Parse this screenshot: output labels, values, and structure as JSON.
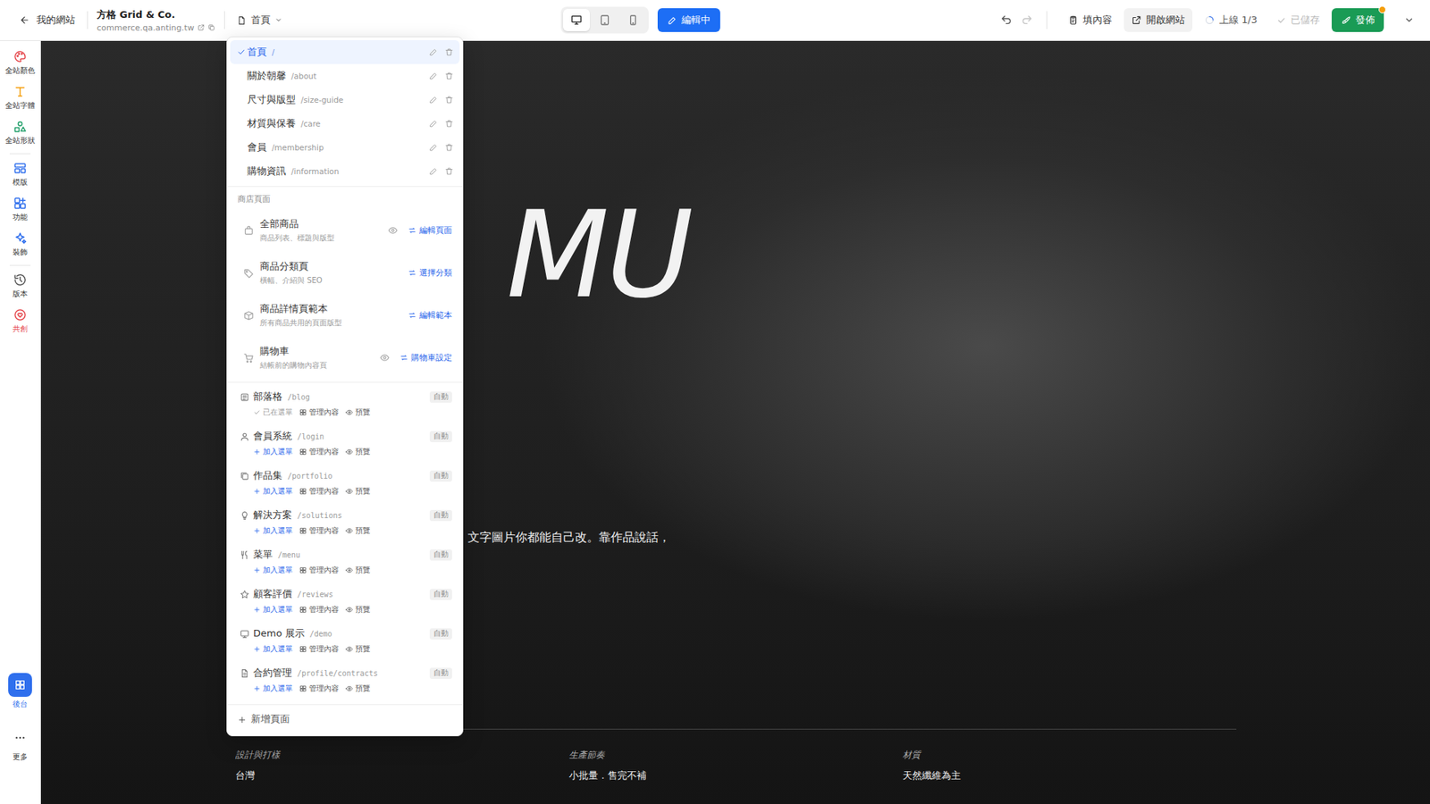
{
  "topbar": {
    "back": "我的網站",
    "site_name": "方格 Grid & Co.",
    "domain": "commerce.qa.anting.tw",
    "page_select": "首頁",
    "devices": [
      {
        "kind": "desktop",
        "selected": true
      },
      {
        "kind": "tablet",
        "selected": false
      },
      {
        "kind": "mobile",
        "selected": false
      }
    ],
    "edit_button": {
      "label": "編輯中",
      "selected": true
    },
    "undo": {
      "disabled": false
    },
    "redo": {
      "disabled": true
    },
    "fill_button": "填內容",
    "open_site": "開啟網站",
    "online": {
      "label": "上線 1/3",
      "loading": true
    },
    "saved": {
      "label": "已儲存",
      "disabled": true
    },
    "publish": {
      "label": "發佈",
      "pending_dot": true
    }
  },
  "sidebar": {
    "items": [
      {
        "label": "全站顏色",
        "color": "#e5484d",
        "highlight": false
      },
      {
        "label": "全站字體",
        "color": "#f59e0b",
        "highlight": false
      },
      {
        "label": "全站形狀",
        "color": "#22a06b",
        "highlight": false
      },
      {
        "label": "模版",
        "color": "#2f6fed",
        "highlight": false
      },
      {
        "label": "功能",
        "color": "#2f6fed",
        "highlight": false
      },
      {
        "label": "裝飾",
        "color": "#2f6fed",
        "highlight": false
      },
      {
        "label": "版本",
        "color": "#555555",
        "highlight": false
      },
      {
        "label": "共創",
        "color": "#e5484d",
        "highlight": true
      }
    ],
    "bottom": [
      {
        "label": "後台",
        "selected": true
      },
      {
        "label": "更多",
        "selected": false
      }
    ]
  },
  "page_menu": {
    "pages": [
      {
        "title": "首頁",
        "path": "/",
        "selected": true
      },
      {
        "title": "關於朝馨",
        "path": "/about",
        "selected": false
      },
      {
        "title": "尺寸與版型",
        "path": "/size-guide",
        "selected": false
      },
      {
        "title": "材質與保養",
        "path": "/care",
        "selected": false
      },
      {
        "title": "會員",
        "path": "/membership",
        "selected": false
      },
      {
        "title": "購物資訊",
        "path": "/information",
        "selected": false
      }
    ],
    "store_section": "商店頁面",
    "store_pages": [
      {
        "title": "全部商品",
        "subtitle": "商品列表、標題與版型",
        "preview_eye": true,
        "action": "編輯頁面"
      },
      {
        "title": "商品分類頁",
        "subtitle": "橫幅、介紹與 SEO",
        "preview_eye": false,
        "action": "選擇分類"
      },
      {
        "title": "商品詳情頁範本",
        "subtitle": "所有商品共用的頁面版型",
        "preview_eye": false,
        "action": "編輯範本"
      },
      {
        "title": "購物車",
        "subtitle": "結帳前的購物內容頁",
        "preview_eye": true,
        "action": "購物車設定"
      }
    ],
    "modules": [
      {
        "title": "部落格",
        "path": "/blog",
        "badge": "自動",
        "in_menu": true,
        "menu_label": "已在選單",
        "manage": "管理內容",
        "preview": "預覽"
      },
      {
        "title": "會員系統",
        "path": "/login",
        "badge": "自動",
        "in_menu": false,
        "menu_label": "加入選單",
        "manage": "管理內容",
        "preview": "預覽"
      },
      {
        "title": "作品集",
        "path": "/portfolio",
        "badge": "自動",
        "in_menu": false,
        "menu_label": "加入選單",
        "manage": "管理內容",
        "preview": "預覽"
      },
      {
        "title": "解決方案",
        "path": "/solutions",
        "badge": "自動",
        "in_menu": false,
        "menu_label": "加入選單",
        "manage": "管理內容",
        "preview": "預覽"
      },
      {
        "title": "菜單",
        "path": "/menu",
        "badge": "自動",
        "in_menu": false,
        "menu_label": "加入選單",
        "manage": "管理內容",
        "preview": "預覽"
      },
      {
        "title": "顧客評價",
        "path": "/reviews",
        "badge": "自動",
        "in_menu": false,
        "menu_label": "加入選單",
        "manage": "管理內容",
        "preview": "預覽"
      },
      {
        "title": "Demo 展示",
        "path": "/demo",
        "badge": "自動",
        "in_menu": false,
        "menu_label": "加入選單",
        "manage": "管理內容",
        "preview": "預覽"
      },
      {
        "title": "合約管理",
        "path": "/profile/contracts",
        "badge": "自動",
        "in_menu": false,
        "menu_label": "加入選單",
        "manage": "管理內容",
        "preview": "預覽"
      }
    ],
    "add_page": "新增頁面"
  },
  "hero": {
    "title": "MU",
    "subtitle": "文字圖片你都能自己改。靠作品說話，",
    "facts": [
      {
        "label": "設計與打樣",
        "value": "台灣"
      },
      {
        "label": "生產節奏",
        "value": "小批量．售完不補"
      },
      {
        "label": "材質",
        "value": "天然纖維為主"
      }
    ]
  }
}
